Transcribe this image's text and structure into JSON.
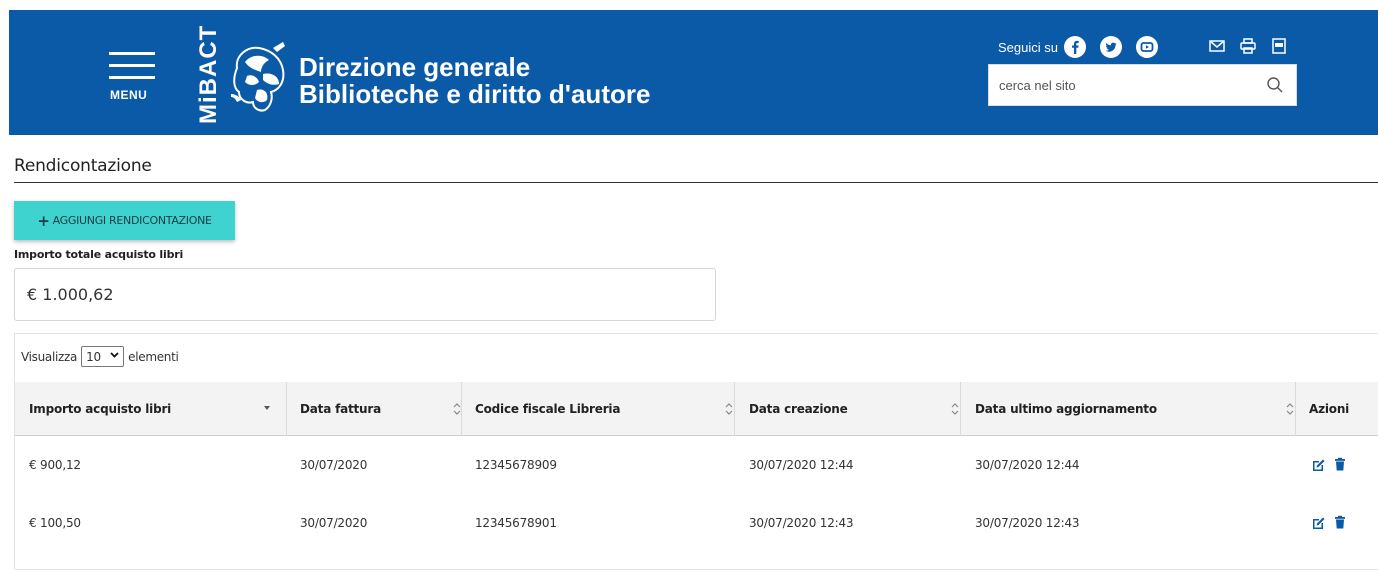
{
  "header": {
    "menu_label": "MENU",
    "logo_text": "MiBACT",
    "site_title_line1": "Direzione generale",
    "site_title_line2": "Biblioteche e diritto d'autore",
    "social_label": "Seguici su",
    "search_placeholder": "cerca nel sito",
    "social_icons": [
      "facebook-icon",
      "twitter-icon",
      "youtube-icon"
    ],
    "utility_icons": [
      "mail-icon",
      "print-icon",
      "pdf-icon"
    ]
  },
  "page": {
    "title": "Rendicontazione",
    "add_button_label": "AGGIUNGI RENDICONTAZIONE",
    "total_label": "Importo totale acquisto libri",
    "total_value": "€ 1.000,62"
  },
  "table": {
    "length_prefix": "Visualizza",
    "length_value": "10",
    "length_suffix": "elementi",
    "columns": [
      "Importo acquisto libri",
      "Data fattura",
      "Codice fiscale Libreria",
      "Data creazione",
      "Data ultimo aggiornamento",
      "Azioni"
    ],
    "rows": [
      [
        "€ 900,12",
        "30/07/2020",
        "12345678909",
        "30/07/2020 12:44",
        "30/07/2020 12:44"
      ],
      [
        "€ 100,50",
        "30/07/2020",
        "12345678901",
        "30/07/2020 12:43",
        "30/07/2020 12:43"
      ]
    ]
  },
  "colors": {
    "header_bg": "#0b5aa8",
    "add_button_bg": "#3ed3cf",
    "action_icon": "#0b5aa8"
  }
}
